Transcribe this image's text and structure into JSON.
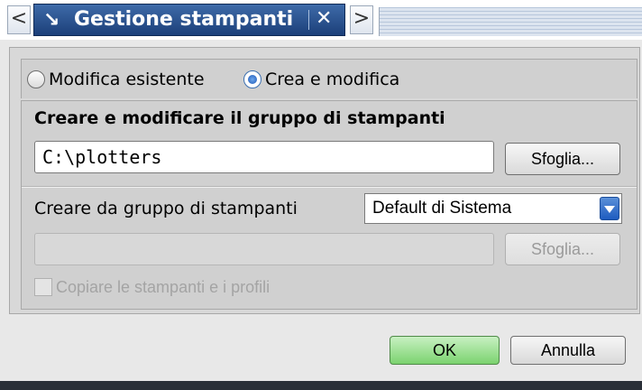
{
  "titlebar": {
    "prev_glyph": "<",
    "pin_glyph": "↘",
    "title": "Gestione stampanti",
    "close_glyph": "✕",
    "next_glyph": ">",
    "icons": {
      "prev": "chevron-left-icon",
      "pin": "pin-icon",
      "close": "close-icon",
      "next": "chevron-right-icon"
    }
  },
  "mode": {
    "options": [
      {
        "label": "Modifica esistente",
        "selected": false
      },
      {
        "label": "Crea e modifica",
        "selected": true
      }
    ]
  },
  "group": {
    "title": "Creare e modificare il gruppo di stampanti",
    "path_value": "C:\\plotters",
    "browse_label": "Sfoglia...",
    "from_label": "Creare da gruppo di stampanti",
    "from_selected": "Default di Sistema",
    "from_path_value": "",
    "browse_disabled_label": "Sfoglia...",
    "copy_label": "Copiare le stampanti e i profili",
    "copy_checked": false
  },
  "footer": {
    "ok_label": "OK",
    "cancel_label": "Annulla"
  },
  "colors": {
    "title_tab": "#2a5494",
    "ok_button": "#7bd36f",
    "radio_selected": "#1b57b8",
    "dropdown_arrow": "#1e5cc0"
  }
}
